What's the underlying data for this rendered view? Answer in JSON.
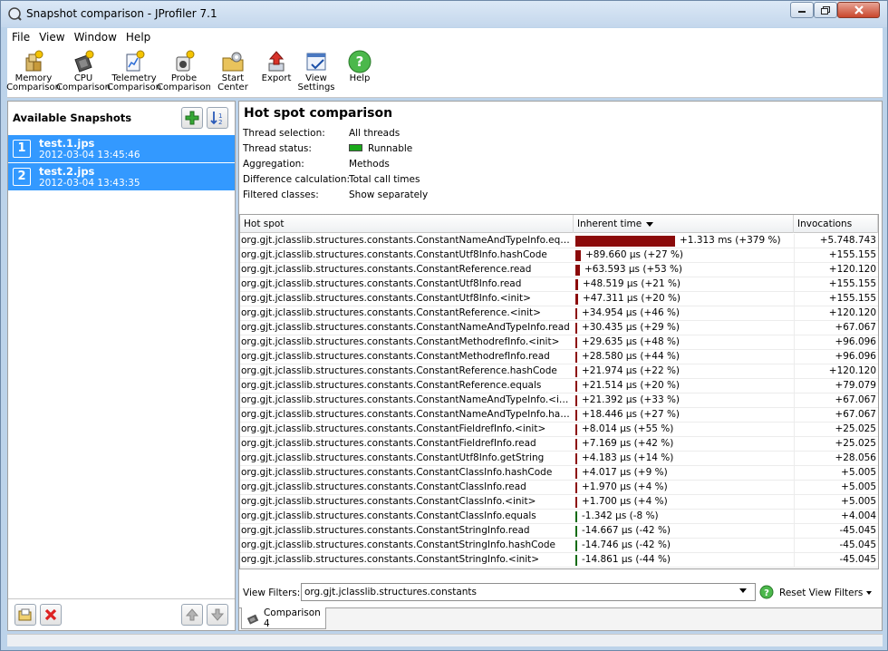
{
  "window": {
    "title": "Snapshot comparison - JProfiler 7.1"
  },
  "menu": [
    "File",
    "View",
    "Window",
    "Help"
  ],
  "toolbar": {
    "buttons": [
      {
        "label1": "Memory",
        "label2": "Comparison",
        "icon": "memory-comparison-icon"
      },
      {
        "label1": "CPU",
        "label2": "Comparison",
        "icon": "cpu-comparison-icon"
      },
      {
        "label1": "Telemetry",
        "label2": "Comparison",
        "icon": "telemetry-comparison-icon"
      },
      {
        "label1": "Probe",
        "label2": "Comparison",
        "icon": "probe-comparison-icon"
      },
      {
        "label1": "Start",
        "label2": "Center",
        "icon": "start-center-icon"
      },
      {
        "label1": "Export",
        "label2": "",
        "icon": "export-icon"
      },
      {
        "label1": "View",
        "label2": "Settings",
        "icon": "view-settings-icon"
      },
      {
        "label1": "Help",
        "label2": "",
        "icon": "help-icon"
      }
    ]
  },
  "left": {
    "title": "Available Snapshots",
    "snapshots": [
      {
        "num": "1",
        "name": "test.1.jps",
        "date": "2012-03-04 13:45:46"
      },
      {
        "num": "2",
        "name": "test.2.jps",
        "date": "2012-03-04 13:43:35"
      }
    ]
  },
  "main": {
    "title": "Hot spot comparison",
    "props": [
      {
        "label": "Thread selection:",
        "value": "All threads"
      },
      {
        "label": "Thread status:",
        "value": "Runnable"
      },
      {
        "label": "Aggregation:",
        "value": "Methods"
      },
      {
        "label": "Difference calculation:",
        "value": "Total call times"
      },
      {
        "label": "Filtered classes:",
        "value": "Show separately"
      }
    ],
    "status_color": "#1aaa1a",
    "bar_color_positive": "#8b0a0a",
    "bar_color_negative": "#0f6b0f",
    "table": {
      "columns": [
        "Hot spot",
        "Inherent time",
        "Invocations"
      ],
      "rows": [
        {
          "hotspot": "org.gjt.jclasslib.structures.constants.ConstantNameAndTypeInfo.equals",
          "time": "+1.313 ms (+379 %)",
          "inv": "+5.748.743",
          "delta_us": 1313
        },
        {
          "hotspot": "org.gjt.jclasslib.structures.constants.ConstantUtf8Info.hashCode",
          "time": "+89.660 µs (+27 %)",
          "inv": "+155.155",
          "delta_us": 89.66
        },
        {
          "hotspot": "org.gjt.jclasslib.structures.constants.ConstantReference.read",
          "time": "+63.593 µs (+53 %)",
          "inv": "+120.120",
          "delta_us": 63.593
        },
        {
          "hotspot": "org.gjt.jclasslib.structures.constants.ConstantUtf8Info.read",
          "time": "+48.519 µs (+21 %)",
          "inv": "+155.155",
          "delta_us": 48.519
        },
        {
          "hotspot": "org.gjt.jclasslib.structures.constants.ConstantUtf8Info.<init>",
          "time": "+47.311 µs (+20 %)",
          "inv": "+155.155",
          "delta_us": 47.311
        },
        {
          "hotspot": "org.gjt.jclasslib.structures.constants.ConstantReference.<init>",
          "time": "+34.954 µs (+46 %)",
          "inv": "+120.120",
          "delta_us": 34.954
        },
        {
          "hotspot": "org.gjt.jclasslib.structures.constants.ConstantNameAndTypeInfo.read",
          "time": "+30.435 µs (+29 %)",
          "inv": "+67.067",
          "delta_us": 30.435
        },
        {
          "hotspot": "org.gjt.jclasslib.structures.constants.ConstantMethodrefInfo.<init>",
          "time": "+29.635 µs (+48 %)",
          "inv": "+96.096",
          "delta_us": 29.635
        },
        {
          "hotspot": "org.gjt.jclasslib.structures.constants.ConstantMethodrefInfo.read",
          "time": "+28.580 µs (+44 %)",
          "inv": "+96.096",
          "delta_us": 28.58
        },
        {
          "hotspot": "org.gjt.jclasslib.structures.constants.ConstantReference.hashCode",
          "time": "+21.974 µs (+22 %)",
          "inv": "+120.120",
          "delta_us": 21.974
        },
        {
          "hotspot": "org.gjt.jclasslib.structures.constants.ConstantReference.equals",
          "time": "+21.514 µs (+20 %)",
          "inv": "+79.079",
          "delta_us": 21.514
        },
        {
          "hotspot": "org.gjt.jclasslib.structures.constants.ConstantNameAndTypeInfo.<init>",
          "time": "+21.392 µs (+33 %)",
          "inv": "+67.067",
          "delta_us": 21.392
        },
        {
          "hotspot": "org.gjt.jclasslib.structures.constants.ConstantNameAndTypeInfo.hashC...",
          "time": "+18.446 µs (+27 %)",
          "inv": "+67.067",
          "delta_us": 18.446
        },
        {
          "hotspot": "org.gjt.jclasslib.structures.constants.ConstantFieldrefInfo.<init>",
          "time": "+8.014 µs (+55 %)",
          "inv": "+25.025",
          "delta_us": 8.014
        },
        {
          "hotspot": "org.gjt.jclasslib.structures.constants.ConstantFieldrefInfo.read",
          "time": "+7.169 µs (+42 %)",
          "inv": "+25.025",
          "delta_us": 7.169
        },
        {
          "hotspot": "org.gjt.jclasslib.structures.constants.ConstantUtf8Info.getString",
          "time": "+4.183 µs (+14 %)",
          "inv": "+28.056",
          "delta_us": 4.183
        },
        {
          "hotspot": "org.gjt.jclasslib.structures.constants.ConstantClassInfo.hashCode",
          "time": "+4.017 µs (+9 %)",
          "inv": "+5.005",
          "delta_us": 4.017
        },
        {
          "hotspot": "org.gjt.jclasslib.structures.constants.ConstantClassInfo.read",
          "time": "+1.970 µs (+4 %)",
          "inv": "+5.005",
          "delta_us": 1.97
        },
        {
          "hotspot": "org.gjt.jclasslib.structures.constants.ConstantClassInfo.<init>",
          "time": "+1.700 µs (+4 %)",
          "inv": "+5.005",
          "delta_us": 1.7
        },
        {
          "hotspot": "org.gjt.jclasslib.structures.constants.ConstantClassInfo.equals",
          "time": "-1.342 µs (-8 %)",
          "inv": "+4.004",
          "delta_us": -1.342
        },
        {
          "hotspot": "org.gjt.jclasslib.structures.constants.ConstantStringInfo.read",
          "time": "-14.667 µs (-42 %)",
          "inv": "-45.045",
          "delta_us": -14.667
        },
        {
          "hotspot": "org.gjt.jclasslib.structures.constants.ConstantStringInfo.hashCode",
          "time": "-14.746 µs (-42 %)",
          "inv": "-45.045",
          "delta_us": -14.746
        },
        {
          "hotspot": "org.gjt.jclasslib.structures.constants.ConstantStringInfo.<init>",
          "time": "-14.861 µs (-44 %)",
          "inv": "-45.045",
          "delta_us": -14.861
        }
      ]
    },
    "view_filters": {
      "label": "View Filters:",
      "value": "org.gjt.jclasslib.structures.constants",
      "reset_label": "Reset View Filters"
    },
    "tabs": [
      "Comparison 4"
    ]
  }
}
